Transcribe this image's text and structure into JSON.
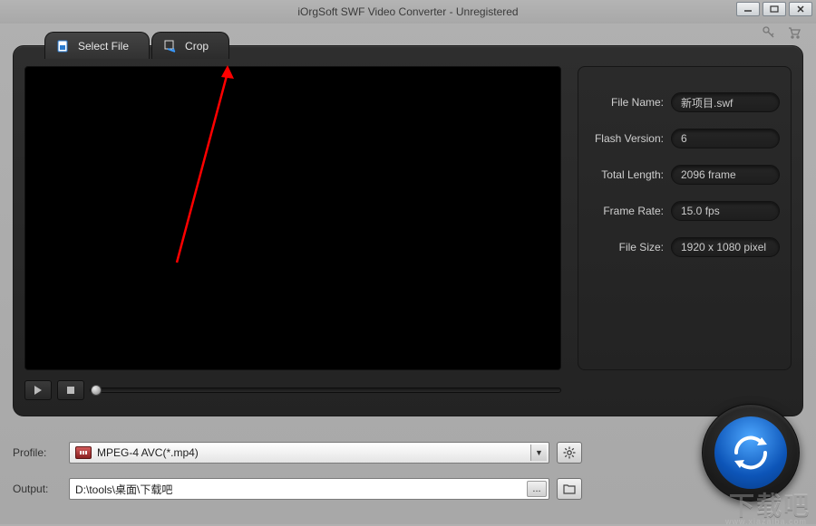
{
  "window": {
    "title": "iOrgSoft SWF Video Converter - Unregistered"
  },
  "tabs": {
    "select_file": "Select File",
    "crop": "Crop"
  },
  "info": {
    "file_name_label": "File Name:",
    "file_name": "新项目.swf",
    "flash_version_label": "Flash Version:",
    "flash_version": "6",
    "total_length_label": "Total Length:",
    "total_length": "2096 frame",
    "frame_rate_label": "Frame Rate:",
    "frame_rate": "15.0 fps",
    "file_size_label": "File Size:",
    "file_size": "1920 x 1080 pixel"
  },
  "bottom": {
    "profile_label": "Profile:",
    "profile_value": "MPEG-4 AVC(*.mp4)",
    "output_label": "Output:",
    "output_path": "D:\\tools\\桌面\\下载吧",
    "browse": "..."
  },
  "watermark": {
    "text": "下载吧",
    "url": "www.xiazaiba.com"
  }
}
